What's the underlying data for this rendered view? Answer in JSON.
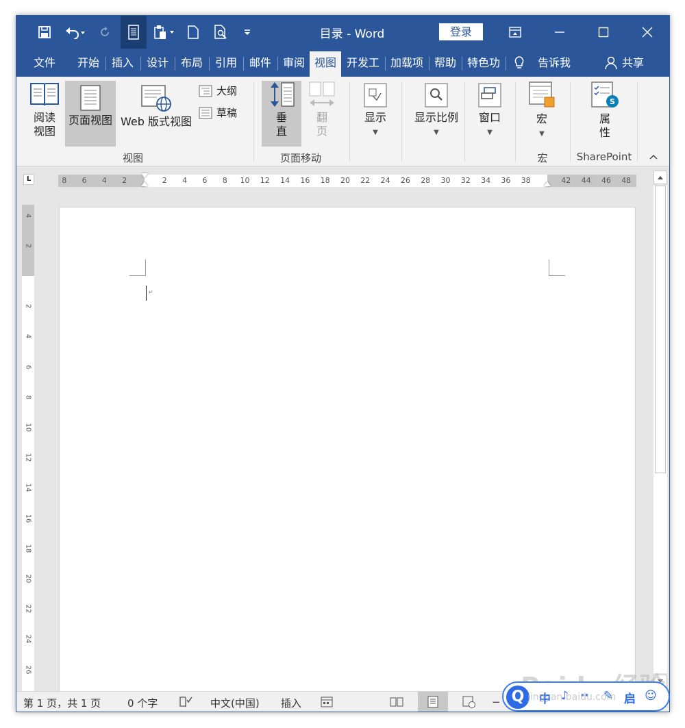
{
  "window": {
    "title": "目录 - Word",
    "login_label": "登录"
  },
  "menu": {
    "tabs": [
      {
        "label": "文件"
      },
      {
        "label": "开始"
      },
      {
        "label": "插入"
      },
      {
        "label": "设计"
      },
      {
        "label": "布局"
      },
      {
        "label": "引用"
      },
      {
        "label": "邮件"
      },
      {
        "label": "审阅"
      },
      {
        "label": "视图",
        "active": true
      },
      {
        "label": "开发工"
      },
      {
        "label": "加载项"
      },
      {
        "label": "帮助"
      },
      {
        "label": "特色功"
      }
    ],
    "tell_me": "告诉我",
    "share": "共享"
  },
  "ribbon": {
    "views": {
      "read_mode_l1": "阅读",
      "read_mode_l2": "视图",
      "print_layout": "页面视图",
      "web_layout": "Web 版式视图",
      "outline": "大纲",
      "draft": "草稿",
      "group_label": "视图"
    },
    "page_movement": {
      "vertical_l1": "垂",
      "vertical_l2": "直",
      "side_l1": "翻",
      "side_l2": "页",
      "group_label": "页面移动"
    },
    "show": {
      "label": "显示"
    },
    "zoom": {
      "label": "显示比例"
    },
    "window": {
      "label": "窗口"
    },
    "macros": {
      "label": "宏",
      "group_label": "宏"
    },
    "sharepoint": {
      "l1": "属",
      "l2": "性",
      "group_label": "SharePoint"
    }
  },
  "ruler": {
    "tab_selector": "L",
    "h_ticks": [
      "8",
      "6",
      "4",
      "2",
      "2",
      "4",
      "6",
      "8",
      "10",
      "12",
      "14",
      "16",
      "18",
      "20",
      "22",
      "24",
      "26",
      "28",
      "30",
      "32",
      "34",
      "36",
      "38",
      "42",
      "44",
      "46",
      "48"
    ],
    "v_ticks": [
      "4",
      "2",
      "2",
      "4",
      "6",
      "8",
      "10",
      "12",
      "14",
      "16",
      "18",
      "20",
      "22",
      "24",
      "26"
    ]
  },
  "document": {
    "paragraph_mark": "↵"
  },
  "status": {
    "page": "第 1 页，共 1 页",
    "words": "0 个字",
    "language": "中文(中国)",
    "mode": "插入",
    "zoom_minus": "−"
  },
  "overlay": {
    "logo": "Q",
    "items": [
      "中",
      "♪",
      "··",
      "✎",
      "启",
      "☺"
    ],
    "watermark": "Baidu 经验",
    "watermark_url": "jingyan.baidu.com"
  },
  "colors": {
    "word_blue": "#2b579a",
    "ribbon_bg": "#f3f3f3",
    "baidu_blue": "#2e6be6"
  }
}
